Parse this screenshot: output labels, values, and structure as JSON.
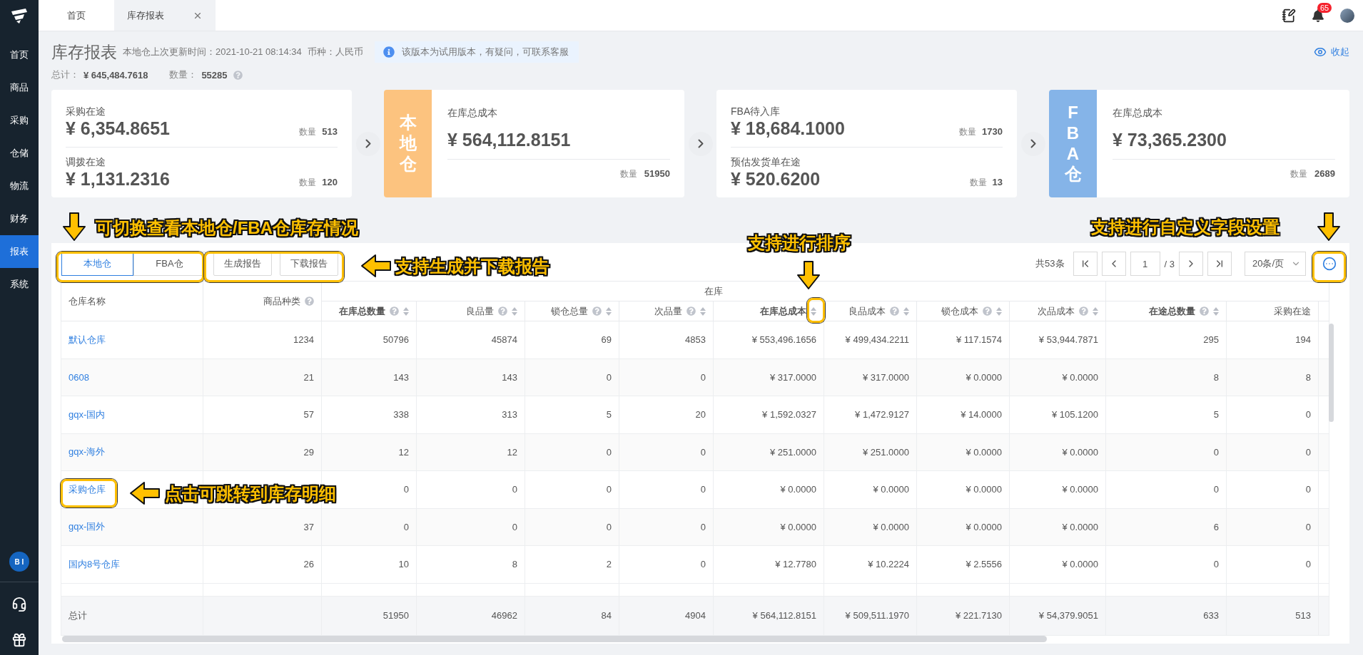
{
  "nav_tabs": [
    {
      "label": "首页",
      "selected": false,
      "closable": false
    },
    {
      "label": "库存报表",
      "selected": true,
      "closable": true
    }
  ],
  "notification_count": "65",
  "sidebar": {
    "items": [
      {
        "label": "首页",
        "selected": false
      },
      {
        "label": "商品",
        "selected": false
      },
      {
        "label": "采购",
        "selected": false
      },
      {
        "label": "仓储",
        "selected": false
      },
      {
        "label": "物流",
        "selected": false
      },
      {
        "label": "财务",
        "selected": false
      },
      {
        "label": "报表",
        "selected": true
      },
      {
        "label": "系统",
        "selected": false
      }
    ],
    "bi_badge": "B I"
  },
  "page": {
    "title": "库存报表",
    "update_info": "本地仓上次更新时间：2021-10-21 08:14:34",
    "currency": "币种：人民币",
    "notice": "该版本为试用版本，有疑问，可联系客服",
    "collapse": "收起",
    "total_label": "总计：",
    "total_value": "¥ 645,484.7618",
    "count_label": "数量：",
    "count_value": "55285"
  },
  "cards": [
    {
      "kind": "split",
      "sections": [
        {
          "title": "采购在途",
          "amount": "¥ 6,354.8651",
          "count_label": "数量",
          "count": "513"
        },
        {
          "title": "调拨在途",
          "amount": "¥ 1,131.2316",
          "count_label": "数量",
          "count": "120"
        }
      ]
    },
    {
      "kind": "banner",
      "banner": "本地仓",
      "color": "#fcc37f",
      "title": "在库总成本",
      "amount": "¥ 564,112.8151",
      "count_label": "数量",
      "count": "51950"
    },
    {
      "kind": "split",
      "sections": [
        {
          "title": "FBA待入库",
          "amount": "¥ 18,684.1000",
          "count_label": "数量",
          "count": "1730"
        },
        {
          "title": "预估发货单在途",
          "amount": "¥ 520.6200",
          "count_label": "数量",
          "count": "13"
        }
      ]
    },
    {
      "kind": "banner",
      "banner": "FBA仓",
      "color": "#85b4e8",
      "title": "在库总成本",
      "amount": "¥ 73,365.2300",
      "count_label": "数量",
      "count": "2689"
    }
  ],
  "toolbar": {
    "segments": [
      {
        "label": "本地仓",
        "selected": true
      },
      {
        "label": "FBA仓",
        "selected": false
      }
    ],
    "buttons": [
      "生成报告",
      "下载报告"
    ],
    "pagination": {
      "total": "共53条",
      "page": "1",
      "of": "/ 3",
      "size": "20条/页"
    }
  },
  "table": {
    "group_label": "在库",
    "columns": [
      {
        "label": "仓库名称",
        "help": false,
        "sortable": false,
        "emphasized": false
      },
      {
        "label": "商品种类",
        "help": true,
        "sortable": false,
        "emphasized": false
      },
      {
        "label": "在库总数量",
        "help": true,
        "sortable": true,
        "emphasized": true
      },
      {
        "label": "良品量",
        "help": true,
        "sortable": true,
        "emphasized": false
      },
      {
        "label": "锁仓总量",
        "help": true,
        "sortable": true,
        "emphasized": false
      },
      {
        "label": "次品量",
        "help": true,
        "sortable": true,
        "emphasized": false
      },
      {
        "label": "在库总成本",
        "help": false,
        "sortable": true,
        "emphasized": true
      },
      {
        "label": "良品成本",
        "help": true,
        "sortable": true,
        "emphasized": false
      },
      {
        "label": "锁仓成本",
        "help": true,
        "sortable": true,
        "emphasized": false
      },
      {
        "label": "次品成本",
        "help": true,
        "sortable": true,
        "emphasized": false
      },
      {
        "label": "在途总数量",
        "help": true,
        "sortable": true,
        "emphasized": true
      },
      {
        "label": "采购在途",
        "help": false,
        "sortable": false,
        "emphasized": false
      }
    ],
    "rows": [
      [
        "默认仓库",
        "1234",
        "50796",
        "45874",
        "69",
        "4853",
        "¥ 553,496.1656",
        "¥ 499,434.2211",
        "¥ 117.1574",
        "¥ 53,944.7871",
        "295",
        "194"
      ],
      [
        "0608",
        "21",
        "143",
        "143",
        "0",
        "0",
        "¥ 317.0000",
        "¥ 317.0000",
        "¥ 0.0000",
        "¥ 0.0000",
        "8",
        "8"
      ],
      [
        "gqx-国内",
        "57",
        "338",
        "313",
        "5",
        "20",
        "¥ 1,592.0327",
        "¥ 1,472.9127",
        "¥ 14.0000",
        "¥ 105.1200",
        "5",
        "0"
      ],
      [
        "gqx-海外",
        "29",
        "12",
        "12",
        "0",
        "0",
        "¥ 251.0000",
        "¥ 251.0000",
        "¥ 0.0000",
        "¥ 0.0000",
        "0",
        "0"
      ],
      [
        "采购仓库",
        null,
        "0",
        "0",
        "0",
        "0",
        "¥ 0.0000",
        "¥ 0.0000",
        "¥ 0.0000",
        "¥ 0.0000",
        "0",
        "0"
      ],
      [
        "gqx-国外",
        "37",
        "0",
        "0",
        "0",
        "0",
        "¥ 0.0000",
        "¥ 0.0000",
        "¥ 0.0000",
        "¥ 0.0000",
        "6",
        "0"
      ],
      [
        "国内8号仓库",
        "26",
        "10",
        "8",
        "2",
        "0",
        "¥ 12.7780",
        "¥ 10.2224",
        "¥ 2.5556",
        "¥ 0.0000",
        "0",
        "0"
      ]
    ],
    "total_row": [
      "总计",
      "51950",
      "46962",
      "84",
      "4904",
      "¥ 564,112.8151",
      "¥ 509,511.1970",
      "¥ 221.7130",
      "¥ 54,379.9051",
      "633",
      "513"
    ]
  },
  "callouts": [
    {
      "text": "可切换查看本地仓/FBA仓库存情况",
      "kind": "down"
    },
    {
      "text": "支持生成并下载报告",
      "kind": "left"
    },
    {
      "text": "支持进行排序",
      "kind": "down"
    },
    {
      "text": "支持进行自定义字段设置",
      "kind": "down"
    },
    {
      "text": "点击可跳转到库存明细",
      "kind": "left"
    }
  ]
}
